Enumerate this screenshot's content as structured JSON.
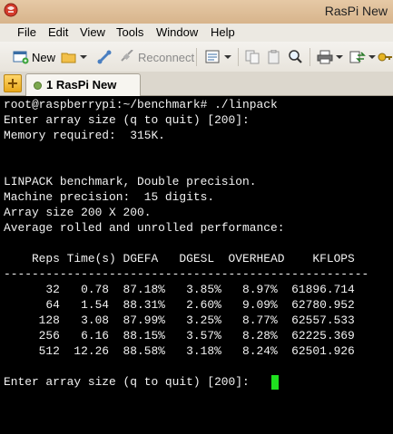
{
  "window": {
    "title": "RasPi New"
  },
  "menu": [
    "File",
    "Edit",
    "View",
    "Tools",
    "Window",
    "Help"
  ],
  "toolbar": {
    "new_label": "New",
    "reconnect_label": "Reconnect"
  },
  "tab": {
    "label": "1 RasPi New"
  },
  "terminal": {
    "lines": [
      "root@raspberrypi:~/benchmark# ./linpack",
      "Enter array size (q to quit) [200]:",
      "Memory required:  315K.",
      "",
      "",
      "LINPACK benchmark, Double precision.",
      "Machine precision:  15 digits.",
      "Array size 200 X 200.",
      "Average rolled and unrolled performance:",
      "",
      "    Reps Time(s) DGEFA   DGESL  OVERHEAD    KFLOPS",
      "----------------------------------------------------",
      "      32   0.78  87.18%   3.85%   8.97%  61896.714",
      "      64   1.54  88.31%   2.60%   9.09%  62780.952",
      "     128   3.08  87.99%   3.25%   8.77%  62557.533",
      "     256   6.16  88.15%   3.57%   8.28%  62225.369",
      "     512  12.26  88.58%   3.18%   8.24%  62501.926",
      "",
      "Enter array size (q to quit) [200]:"
    ]
  },
  "colors": {
    "terminal_bg": "#000000",
    "terminal_fg": "#f2f2f2",
    "cursor": "#1fe01f"
  }
}
